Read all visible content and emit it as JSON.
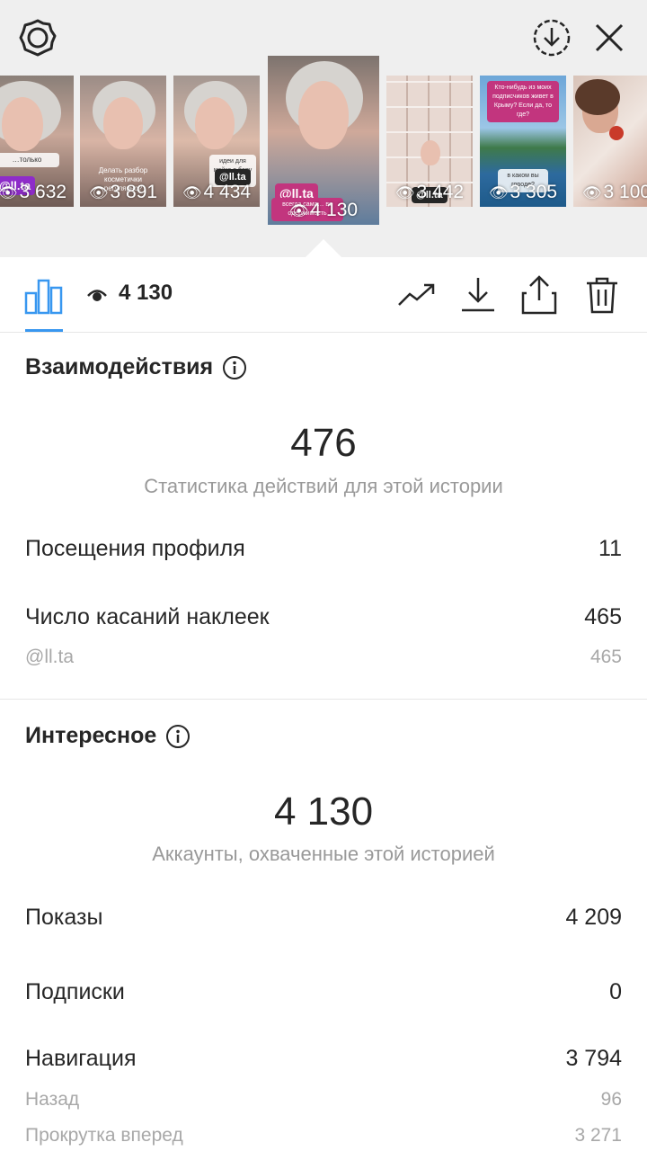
{
  "header": {
    "settings_icon": "gear-icon",
    "download_icon": "download-circle-icon",
    "close_icon": "close-icon"
  },
  "stories": [
    {
      "views": "3 632",
      "tag": "@ll.ta",
      "caption": "…только"
    },
    {
      "views": "3 891",
      "caption": "Делать разбор косметички регулярно?"
    },
    {
      "views": "4 434",
      "tag": "@ll.ta",
      "caption": "идеи для мейка в бору у озёр"
    },
    {
      "views": "4 130",
      "tag": "@ll.ta",
      "caption": "всегда сама… во одержимость",
      "selected": true
    },
    {
      "views": "3 442",
      "tag": "@ll.ta"
    },
    {
      "views": "3 305",
      "caption": "Кто-нибудь из моих подписчиков живет в Крыму? Если да, то где?",
      "caption2": "в каком вы городе?"
    },
    {
      "views": "3 100"
    }
  ],
  "toolbar": {
    "views_count": "4 130",
    "accent": "#3897f0"
  },
  "interactions": {
    "title": "Взаимодействия",
    "total": "476",
    "caption": "Статистика действий для этой истории",
    "rows": [
      {
        "label": "Посещения профиля",
        "value": "11"
      },
      {
        "label": "Число касаний наклеек",
        "value": "465"
      }
    ],
    "sub_rows": [
      {
        "label": "@ll.ta",
        "value": "465"
      }
    ]
  },
  "discovery": {
    "title": "Интересное",
    "total": "4 130",
    "caption": "Аккаунты, охваченные этой историей",
    "rows": [
      {
        "label": "Показы",
        "value": "4 209"
      },
      {
        "label": "Подписки",
        "value": "0"
      },
      {
        "label": "Навигация",
        "value": "3 794"
      }
    ],
    "sub_rows": [
      {
        "label": "Назад",
        "value": "96"
      },
      {
        "label": "Прокрутка вперед",
        "value": "3 271"
      }
    ]
  }
}
